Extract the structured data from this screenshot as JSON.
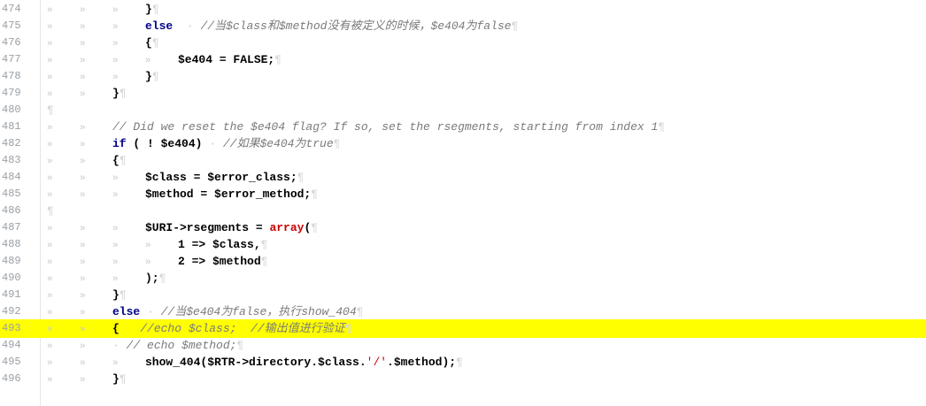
{
  "lines": [
    {
      "n": "474"
    },
    {
      "n": "475"
    },
    {
      "n": "476"
    },
    {
      "n": "477"
    },
    {
      "n": "478"
    },
    {
      "n": "479"
    },
    {
      "n": "480"
    },
    {
      "n": "481"
    },
    {
      "n": "482"
    },
    {
      "n": "483"
    },
    {
      "n": "484"
    },
    {
      "n": "485"
    },
    {
      "n": "486"
    },
    {
      "n": "487"
    },
    {
      "n": "488"
    },
    {
      "n": "489"
    },
    {
      "n": "490"
    },
    {
      "n": "491"
    },
    {
      "n": "492"
    },
    {
      "n": "493"
    },
    {
      "n": "494"
    },
    {
      "n": "495"
    },
    {
      "n": "496"
    }
  ],
  "code": {
    "l474": "}",
    "l475_kw": "else",
    "l475_cmt": "//当$class和$method没有被定义的时候，$e404为false",
    "l476": "{",
    "l477": "$e404 = FALSE;",
    "l478": "}",
    "l479": "}",
    "l481_cmt": "// Did we reset the $e404 flag? If so, set the rsegments, starting from index 1",
    "l482_kw": "if",
    "l482_rest": " ( ! $e404)",
    "l482_cmt": "//如果$e404为true",
    "l483": "{",
    "l484": "$class = $error_class;",
    "l485": "$method = $error_method;",
    "l487_a": "$URI->rsegments = ",
    "l487_kw": "array",
    "l487_b": "(",
    "l488": "1 => $class,",
    "l489": "2 => $method",
    "l490": ");",
    "l491": "}",
    "l492_kw": "else",
    "l492_cmt": "//当$e404为false，执行show_404",
    "l493_brace": "{",
    "l493_cmt": "//echo $class;  //输出值进行验证",
    "l494_cmt": "// echo $method;",
    "l495_a": "show_404($RTR->directory.$class.",
    "l495_str": "'/'",
    "l495_b": ".$method);",
    "l496": "}"
  },
  "pilcrow": "¶",
  "colors": {
    "highlight": "#ffff00",
    "keyword": "#00008b",
    "string": "#cc0000",
    "comment": "#7a7a7a"
  }
}
